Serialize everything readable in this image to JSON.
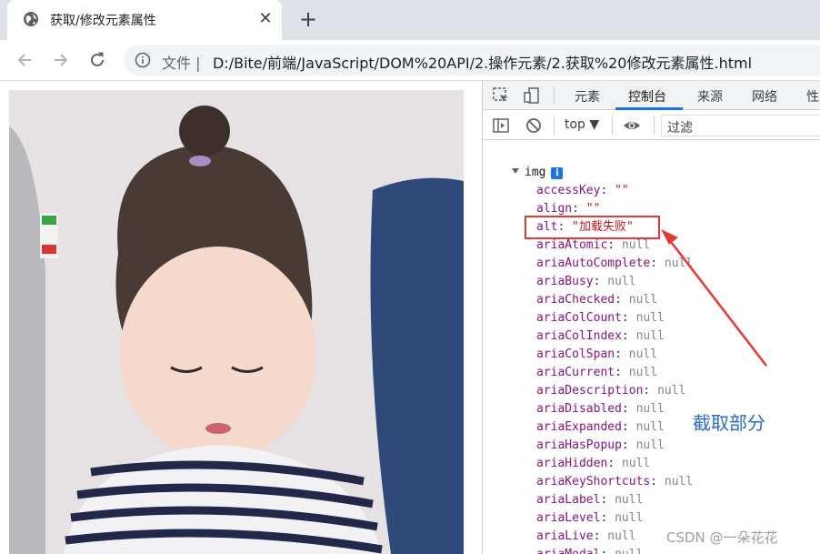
{
  "browser": {
    "tab": {
      "title": "获取/修改元素属性",
      "close_icon": "close-icon",
      "favicon": "globe-icon"
    },
    "new_tab_icon": "plus-icon",
    "nav": {
      "back_icon": "back-arrow-icon",
      "forward_icon": "forward-arrow-icon",
      "reload_icon": "reload-icon"
    },
    "address": {
      "info_icon": "info-circle-icon",
      "scheme_label": "文件 |",
      "url": "D:/Bite/前端/JavaScript/DOM%20API/2.操作元素/2.获取%20修改元素属性.html"
    }
  },
  "devtools": {
    "tabs": [
      {
        "label": "元素",
        "active": false
      },
      {
        "label": "控制台",
        "active": true
      },
      {
        "label": "来源",
        "active": false
      },
      {
        "label": "网络",
        "active": false
      },
      {
        "label": "性",
        "active": false
      }
    ],
    "console_bar": {
      "context": "top ▼",
      "filter_placeholder": "过滤"
    },
    "object": {
      "name": "img",
      "badge": "i",
      "properties": [
        {
          "key": "accessKey",
          "value": "\"\"",
          "type": "string"
        },
        {
          "key": "align",
          "value": "\"\"",
          "type": "string"
        },
        {
          "key": "alt",
          "value": "\"加载失败\"",
          "type": "string"
        },
        {
          "key": "ariaAtomic",
          "value": "null",
          "type": "null"
        },
        {
          "key": "ariaAutoComplete",
          "value": "null",
          "type": "null"
        },
        {
          "key": "ariaBusy",
          "value": "null",
          "type": "null"
        },
        {
          "key": "ariaChecked",
          "value": "null",
          "type": "null"
        },
        {
          "key": "ariaColCount",
          "value": "null",
          "type": "null"
        },
        {
          "key": "ariaColIndex",
          "value": "null",
          "type": "null"
        },
        {
          "key": "ariaColSpan",
          "value": "null",
          "type": "null"
        },
        {
          "key": "ariaCurrent",
          "value": "null",
          "type": "null"
        },
        {
          "key": "ariaDescription",
          "value": "null",
          "type": "null"
        },
        {
          "key": "ariaDisabled",
          "value": "null",
          "type": "null"
        },
        {
          "key": "ariaExpanded",
          "value": "null",
          "type": "null"
        },
        {
          "key": "ariaHasPopup",
          "value": "null",
          "type": "null"
        },
        {
          "key": "ariaHidden",
          "value": "null",
          "type": "null"
        },
        {
          "key": "ariaKeyShortcuts",
          "value": "null",
          "type": "null"
        },
        {
          "key": "ariaLabel",
          "value": "null",
          "type": "null"
        },
        {
          "key": "ariaLevel",
          "value": "null",
          "type": "null"
        },
        {
          "key": "ariaLive",
          "value": "null",
          "type": "null"
        },
        {
          "key": "ariaModal",
          "value": "null",
          "type": "null"
        }
      ]
    }
  },
  "annotation": {
    "label": "截取部分",
    "color": "#2a6ac9",
    "arrow_color": "#e53935"
  },
  "watermark": "CSDN @一朵花花"
}
